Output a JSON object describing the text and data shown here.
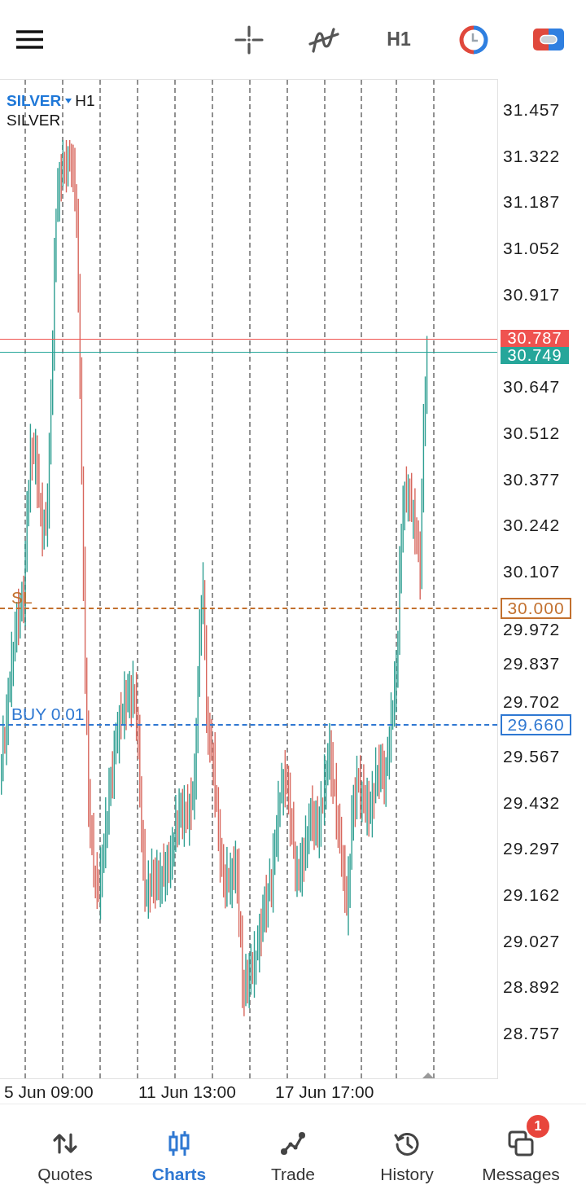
{
  "toolbar": {
    "timeframe": "H1"
  },
  "chart": {
    "symbol": "SILVER",
    "timeframe": "H1",
    "description": "SILVER",
    "price_axis": [
      "31.457",
      "31.322",
      "31.187",
      "31.052",
      "30.917",
      "30.647",
      "30.512",
      "30.377",
      "30.242",
      "30.107",
      "29.972",
      "29.837",
      "29.702",
      "29.567",
      "29.432",
      "29.297",
      "29.162",
      "29.027",
      "28.892",
      "28.757"
    ],
    "price_lines": [
      {
        "kind": "ask",
        "price": "30.787",
        "color": "#ef5350"
      },
      {
        "kind": "bid",
        "price": "30.749",
        "color": "#26a69a"
      },
      {
        "kind": "stop_loss",
        "label": "SL",
        "price": "30.000",
        "color": "#c2702e"
      },
      {
        "kind": "order",
        "label": "BUY 0.01",
        "price": "29.660",
        "color": "#2f78d2"
      }
    ],
    "time_axis": [
      "5 Jun 09:00",
      "11 Jun 13:00",
      "17 Jun 17:00"
    ]
  },
  "nav": [
    {
      "label": "Quotes",
      "selected": false
    },
    {
      "label": "Charts",
      "selected": true
    },
    {
      "label": "Trade",
      "selected": false
    },
    {
      "label": "History",
      "selected": false
    },
    {
      "label": "Messages",
      "selected": false,
      "badge": "1"
    }
  ]
}
